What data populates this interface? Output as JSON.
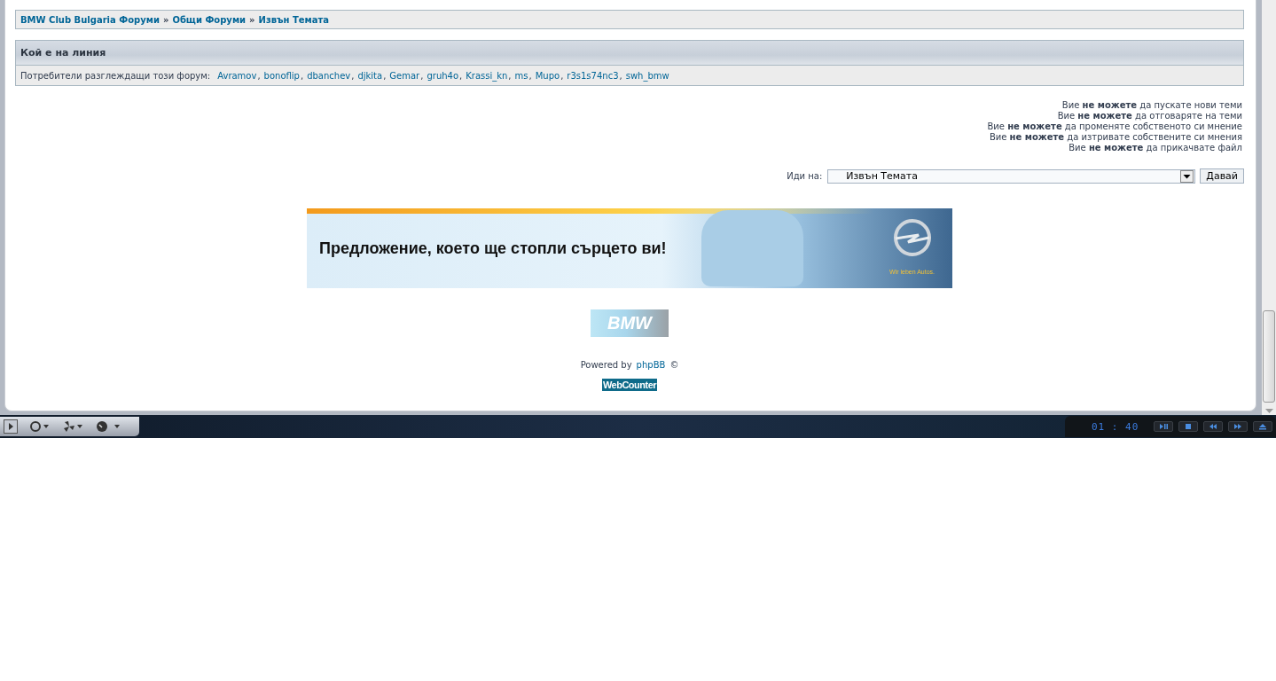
{
  "breadcrumbs": {
    "items": [
      "BMW Club Bulgaria Форуми",
      "Общи Форуми",
      "Извън Темата"
    ],
    "separator": "»"
  },
  "online": {
    "title": "Кой е на линия",
    "label": "Потребители разглеждащи този форум:",
    "separator": ",",
    "users": [
      "Avramov",
      "bonoflip",
      "dbanchev",
      "djkita",
      "Gemar",
      "gruh4o",
      "Krassi_kn",
      "ms",
      "Mupo",
      "r3s1s74nc3",
      "swh_bmw"
    ]
  },
  "permissions": [
    "Вие **не можете** да пускате нови теми",
    "Вие **не можете** да отговаряте на теми",
    "Вие **не можете** да променяте собственото си мнение",
    "Вие **не можете** да изтривате собствените си мнения",
    "Вие **не можете** да прикачвате файл"
  ],
  "jump": {
    "label": "Иди на:",
    "value": "Извън Темата",
    "button": "Давай"
  },
  "banner": {
    "headline": "Предложение, което ще стопли сърцето ви!",
    "slogan": "Wir leben Autos."
  },
  "logo": {
    "text": "BMW"
  },
  "footer": {
    "prefix": "Powered by",
    "link": "phpBB",
    "suffix": "©"
  },
  "counter": {
    "text": "WebCounter"
  },
  "media_player": {
    "time": "01 : 40"
  }
}
